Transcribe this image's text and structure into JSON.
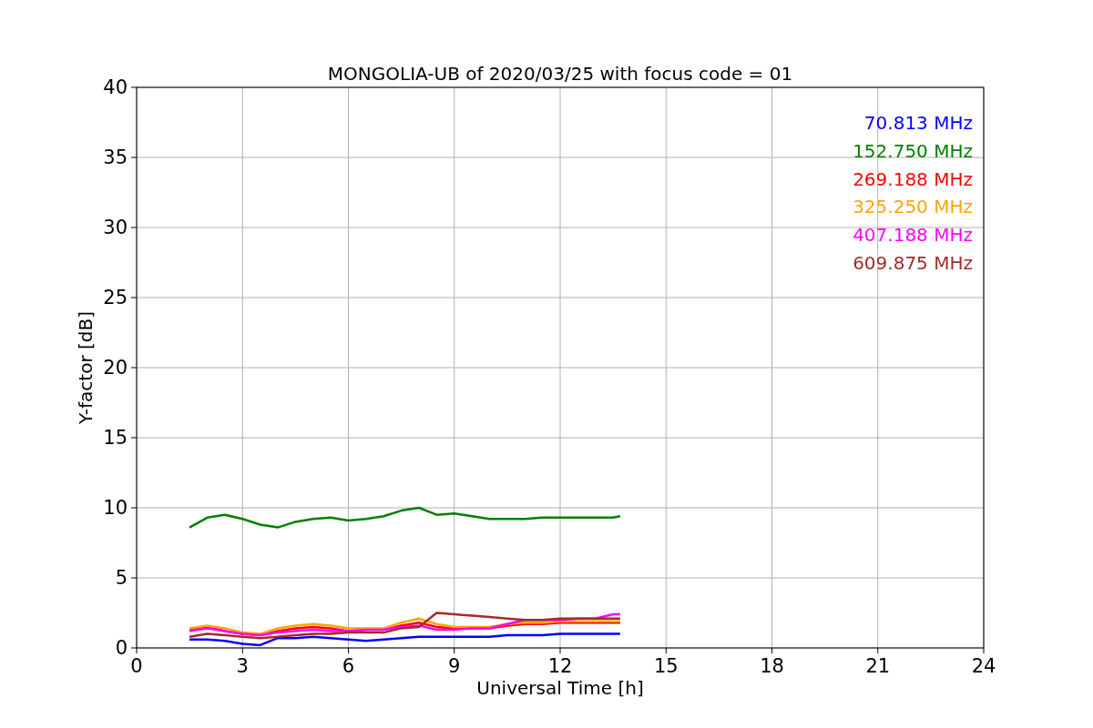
{
  "plot": {
    "chart_data": {
      "type": "line",
      "grid": true,
      "title": "MONGOLIA-UB of 2020/03/25 with focus code = 01",
      "xlabel": "Universal Time [h]",
      "ylabel": "Y-factor [dB]",
      "x": [
        1.5,
        2,
        2.5,
        3,
        3.5,
        4,
        4.5,
        5,
        5.5,
        6,
        6.5,
        7,
        7.5,
        8,
        8.5,
        9,
        9.5,
        10,
        10.5,
        11,
        11.5,
        12,
        12.5,
        13,
        13.5,
        13.7
      ],
      "xlim": [
        0,
        24
      ],
      "ylim": [
        0,
        40
      ],
      "xticks": [
        0,
        3,
        6,
        9,
        12,
        15,
        18,
        21,
        24
      ],
      "yticks": [
        0,
        5,
        10,
        15,
        20,
        25,
        30,
        35,
        40
      ],
      "series": [
        {
          "name": "70.813 MHz",
          "color": "#0000ff",
          "values": [
            0.6,
            0.6,
            0.5,
            0.3,
            0.2,
            0.7,
            0.7,
            0.8,
            0.7,
            0.6,
            0.5,
            0.6,
            0.7,
            0.8,
            0.8,
            0.8,
            0.8,
            0.8,
            0.9,
            0.9,
            0.9,
            1.0,
            1.0,
            1.0,
            1.0,
            1.0
          ]
        },
        {
          "name": "152.750 MHz",
          "color": "#008000",
          "values": [
            8.6,
            9.3,
            9.5,
            9.2,
            8.8,
            8.6,
            9.0,
            9.2,
            9.3,
            9.1,
            9.2,
            9.4,
            9.8,
            10.0,
            9.5,
            9.6,
            9.4,
            9.2,
            9.2,
            9.2,
            9.3,
            9.3,
            9.3,
            9.3,
            9.3,
            9.4
          ]
        },
        {
          "name": "269.188 MHz",
          "color": "#ff0000",
          "values": [
            1.3,
            1.5,
            1.2,
            1.0,
            0.9,
            1.2,
            1.4,
            1.5,
            1.4,
            1.2,
            1.3,
            1.3,
            1.6,
            1.8,
            1.5,
            1.4,
            1.4,
            1.4,
            1.6,
            1.7,
            1.7,
            1.8,
            1.8,
            1.8,
            1.8,
            1.8
          ]
        },
        {
          "name": "325.250 MHz",
          "color": "#ffa500",
          "values": [
            1.4,
            1.6,
            1.4,
            1.1,
            1.0,
            1.4,
            1.6,
            1.7,
            1.6,
            1.4,
            1.4,
            1.4,
            1.8,
            2.1,
            1.7,
            1.5,
            1.5,
            1.5,
            1.7,
            1.8,
            1.8,
            1.9,
            1.9,
            1.9,
            1.9,
            1.9
          ]
        },
        {
          "name": "407.188 MHz",
          "color": "#ff00ff",
          "values": [
            1.2,
            1.4,
            1.2,
            1.0,
            0.9,
            1.1,
            1.2,
            1.3,
            1.2,
            1.2,
            1.3,
            1.3,
            1.5,
            1.6,
            1.3,
            1.3,
            1.4,
            1.4,
            1.7,
            2.0,
            2.0,
            2.0,
            2.1,
            2.1,
            2.4,
            2.4
          ]
        },
        {
          "name": "609.875 MHz",
          "color": "#a52a2a",
          "values": [
            0.8,
            1.0,
            0.9,
            0.8,
            0.7,
            0.8,
            0.9,
            1.0,
            1.0,
            1.1,
            1.1,
            1.1,
            1.4,
            1.5,
            2.5,
            2.4,
            2.3,
            2.2,
            2.1,
            2.0,
            2.0,
            2.1,
            2.1,
            2.1,
            2.1,
            2.1
          ]
        }
      ]
    }
  }
}
